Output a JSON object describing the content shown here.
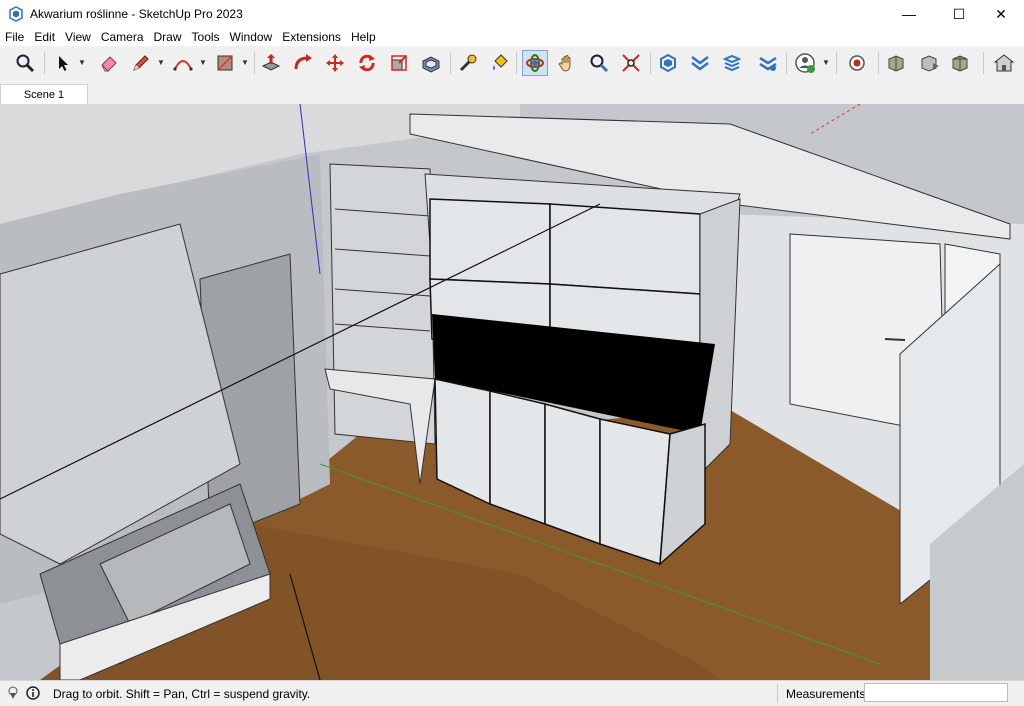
{
  "window": {
    "title": "Akwarium roślinne - SketchUp Pro 2023",
    "minimize_glyph": "—",
    "maximize_glyph": "☐",
    "close_glyph": "✕"
  },
  "menu": [
    "File",
    "Edit",
    "View",
    "Camera",
    "Draw",
    "Tools",
    "Window",
    "Extensions",
    "Help"
  ],
  "toolbar": {
    "tools": [
      {
        "name": "zoom-extents-icon"
      },
      {
        "name": "select-icon",
        "dropdown": true
      },
      {
        "name": "eraser-icon"
      },
      {
        "name": "pencil-line-icon",
        "dropdown": true
      },
      {
        "name": "arc-icon",
        "dropdown": true
      },
      {
        "name": "rectangle-icon",
        "dropdown": true
      },
      {
        "name": "push-pull-icon"
      },
      {
        "name": "follow-me-icon"
      },
      {
        "name": "move-icon"
      },
      {
        "name": "rotate-icon"
      },
      {
        "name": "scale-icon"
      },
      {
        "name": "offset-icon"
      },
      {
        "name": "tape-measure-icon"
      },
      {
        "name": "paint-bucket-icon"
      },
      {
        "name": "orbit-icon",
        "active": true
      },
      {
        "name": "pan-icon"
      },
      {
        "name": "zoom-icon"
      },
      {
        "name": "zoom-window-icon"
      },
      {
        "name": "warehouse-icon"
      },
      {
        "name": "extension-warehouse-icon"
      },
      {
        "name": "layout-icon"
      },
      {
        "name": "extension-manager-icon"
      },
      {
        "name": "profile-icon",
        "dropdown": true
      },
      {
        "name": "record-icon"
      },
      {
        "name": "model-info-icon"
      },
      {
        "name": "components-icon"
      },
      {
        "name": "materials-icon"
      },
      {
        "name": "home-icon"
      }
    ]
  },
  "scenes": [
    {
      "label": "Scene 1"
    }
  ],
  "statusbar": {
    "hint": "Drag to orbit. Shift = Pan, Ctrl = suspend gravity.",
    "measurements_label": "Measurements",
    "measurements_value": ""
  },
  "colors": {
    "accent": "#2f74c0",
    "floor": "#8a5a2b",
    "aquarium": "#000000",
    "wall": "#d8dde1",
    "cabinet": "#e9ecf0"
  }
}
